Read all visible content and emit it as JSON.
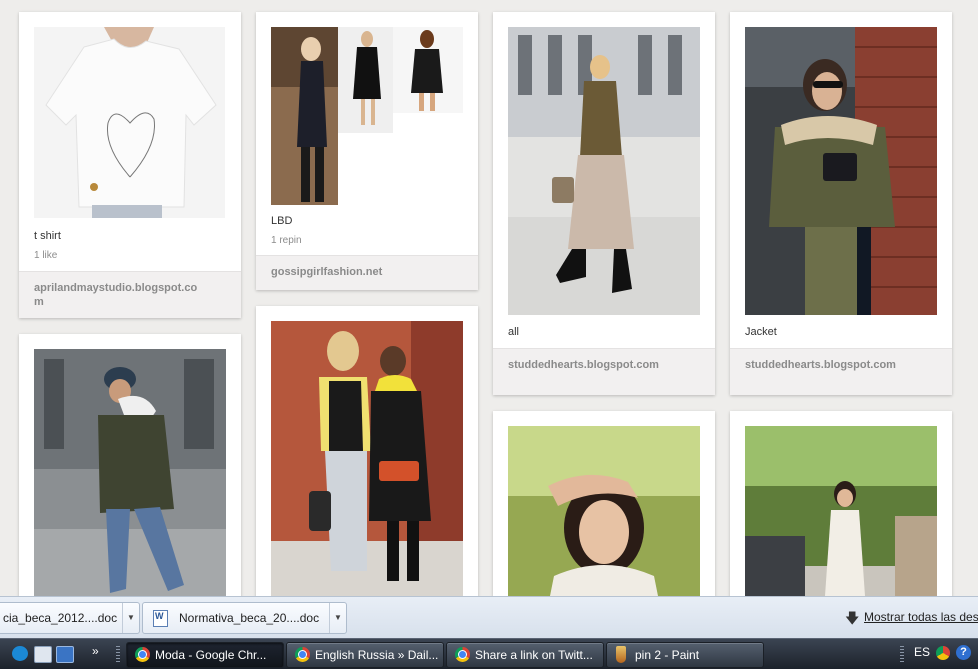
{
  "pins": [
    {
      "description": "t shirt",
      "stat": "1 like",
      "source": "aprilandmaystudio.blogspot.com",
      "photo": "white t-shirt with heart drawing"
    },
    {
      "description": "LBD",
      "stat": "1 repin",
      "source": "gossipgirlfashion.net",
      "photo": "three women in little black dresses"
    },
    {
      "description": "all",
      "stat": "",
      "source": "studdedhearts.blogspot.com",
      "photo": "woman in brown jacket and floral skirt"
    },
    {
      "description": "Jacket",
      "stat": "",
      "source": "studdedhearts.blogspot.com",
      "photo": "woman in green shearling jacket"
    },
    {
      "description": "",
      "stat": "",
      "source": "",
      "photo": "person in green parka walking"
    },
    {
      "description": "",
      "stat": "",
      "source": "",
      "photo": "two women in street style"
    },
    {
      "description": "",
      "stat": "",
      "source": "",
      "photo": "girl with arm raised, lace top"
    },
    {
      "description": "",
      "stat": "",
      "source": "",
      "photo": "woman in white lace dress on street"
    }
  ],
  "downloads": {
    "items": [
      {
        "name": "cia_beca_2012....doc"
      },
      {
        "name": "Normativa_beca_20....doc"
      }
    ],
    "show_all_label": "Mostrar todas las desc"
  },
  "taskbar": {
    "tasks": [
      {
        "label": "Moda - Google Chr...",
        "icon": "chrome-icon",
        "active": true
      },
      {
        "label": "English Russia » Dail...",
        "icon": "chrome-icon",
        "active": false
      },
      {
        "label": "Share a link on Twitt...",
        "icon": "chrome-icon",
        "active": false
      },
      {
        "label": "pin 2 - Paint",
        "icon": "paint-icon",
        "active": false
      }
    ],
    "language": "ES"
  },
  "colors": {
    "board_background": "#eeedeb",
    "pin_background": "#ffffff",
    "source_strip": "#f2f0f0",
    "taskbar": "#1c222b"
  }
}
